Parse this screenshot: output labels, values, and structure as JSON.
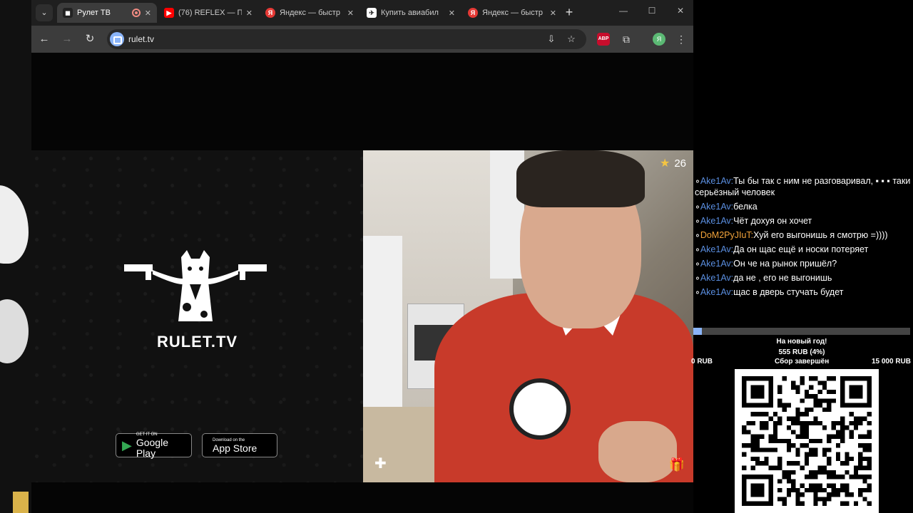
{
  "browser": {
    "tabs": [
      {
        "title": "Рулет ТВ",
        "active": true,
        "recording": true
      },
      {
        "title": "(76) REFLEX — П",
        "active": false
      },
      {
        "title": "Яндекс — быстр",
        "active": false
      },
      {
        "title": "Купить авиабил",
        "active": false
      },
      {
        "title": "Яндекс — быстр",
        "active": false
      }
    ],
    "url": "rulet.tv",
    "profile_initial": "Я",
    "abp_label": "ABP"
  },
  "page": {
    "brand": "RULET.TV",
    "google_play": {
      "small": "GET IT ON",
      "big": "Google Play"
    },
    "app_store": {
      "small": "Download on the",
      "big": "App Store"
    },
    "stars": "26"
  },
  "chat": [
    {
      "user": "Ake1Av:",
      "text": "Ты бы так с ним не разговаривал, ▪ ▪ ▪ таки серьёзный человек",
      "color": "blue"
    },
    {
      "user": "Ake1Av:",
      "text": "белка",
      "color": "blue"
    },
    {
      "user": "Ake1Av:",
      "text": "Чёт дохуя он хочет",
      "color": "blue"
    },
    {
      "user": "DoM2PyJIuT:",
      "text": "Хуй его выгонишь я смотрю =))))",
      "color": "orange"
    },
    {
      "user": "Ake1Av:",
      "text": "Да он щас ещё и носки потеряет",
      "color": "blue"
    },
    {
      "user": "Ake1Av:",
      "text": "Он че на рынок пришёл?",
      "color": "blue"
    },
    {
      "user": "Ake1Av:",
      "text": "да не , его не выгонишь",
      "color": "blue"
    },
    {
      "user": "Ake1Av:",
      "text": "щас в дверь стучать будет",
      "color": "blue"
    }
  ],
  "donation": {
    "title": "На новый год!",
    "amount": "555 RUB (4%)",
    "min": "0 RUB",
    "status": "Сбор завершён",
    "max": "15 000 RUB",
    "progress": 0.04
  }
}
